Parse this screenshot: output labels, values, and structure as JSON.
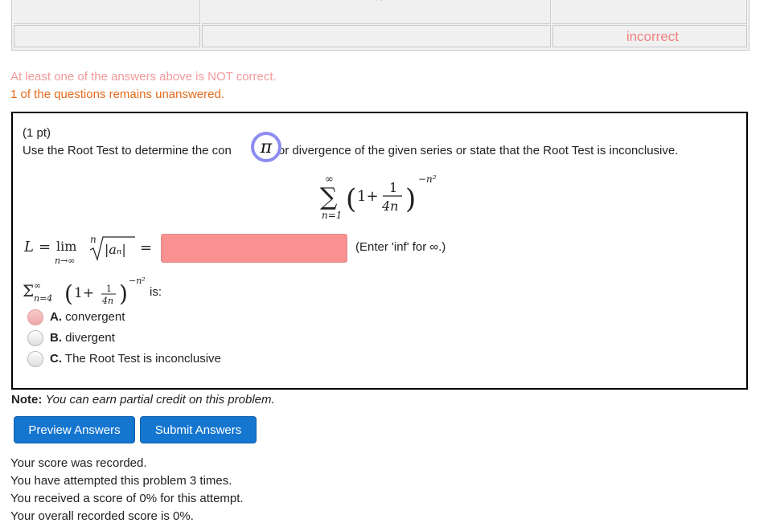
{
  "results": {
    "status": "incorrect",
    "top_symbol": "∞"
  },
  "messages": {
    "not_correct": "At least one of the answers above is NOT correct.",
    "unanswered": "1 of the questions remains unanswered."
  },
  "problem": {
    "points": "(1 pt)",
    "prompt_before": "Use the Root Test to determine the con",
    "prompt_after": "ce or divergence of the given series or state that the Root Test is inconclusive.",
    "pi_symbol": "π",
    "series": {
      "sum_upper": "∞",
      "sum_lower": "n=1",
      "one_plus": "1+",
      "frac_num": "1",
      "frac_den": "4n",
      "exponent": "−n²"
    },
    "limit_label": {
      "L": "L",
      "eq": "=",
      "lim": "lim",
      "lim_sub": "n→∞",
      "root_index": "n",
      "abs_an": "|aₙ|",
      "eq2": "="
    },
    "answer_value": "",
    "hint": "(Enter 'inf' for ∞.)",
    "small_series": {
      "sigma": "Σ",
      "upper": "∞",
      "lower": "n=4",
      "one_plus": "1+",
      "frac_num": "1",
      "frac_den": "4n",
      "exponent": "−n²"
    },
    "is_label": "is:",
    "options": [
      {
        "letter": "A.",
        "text": "convergent"
      },
      {
        "letter": "B.",
        "text": "divergent"
      },
      {
        "letter": "C.",
        "text": "The Root Test is inconclusive"
      }
    ]
  },
  "note": {
    "label": "Note:",
    "text": "You can earn partial credit on this problem."
  },
  "buttons": {
    "preview": "Preview Answers",
    "submit": "Submit Answers"
  },
  "score": {
    "recorded": "Your score was recorded.",
    "attempts": "You have attempted this problem 3 times.",
    "received": "You received a score of 0% for this attempt.",
    "overall": "Your overall recorded score is 0%."
  },
  "colors": {
    "incorrect_text": "#f08080",
    "warning_text": "#e26a1b",
    "answer_field_bg": "#fa9191",
    "button_bg": "#1576d0",
    "pi_ring": "#8c8cf0"
  }
}
